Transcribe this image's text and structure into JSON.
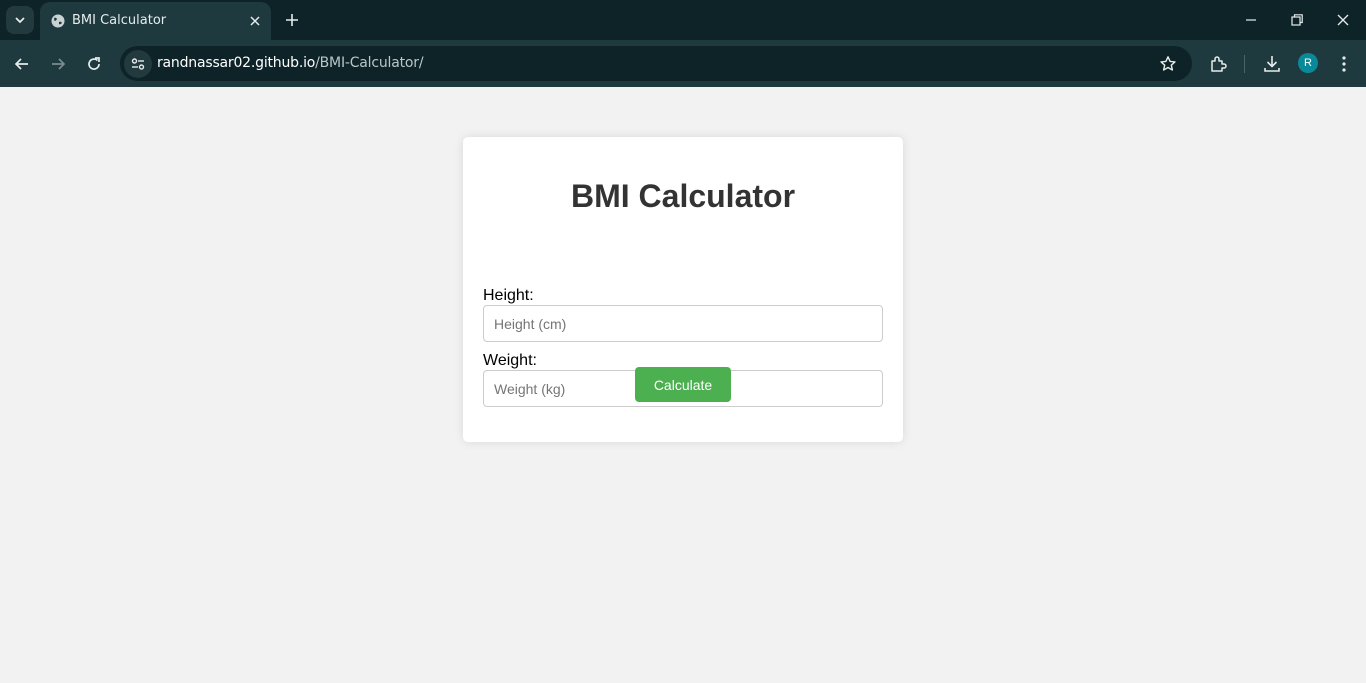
{
  "browser": {
    "tab": {
      "title": "BMI Calculator"
    },
    "address_bar": {
      "host": "randnassar02.github.io",
      "path": "/BMI-Calculator/"
    },
    "profile_initial": "R"
  },
  "app": {
    "title": "BMI Calculator",
    "height": {
      "label": "Height:",
      "placeholder": "Height (cm)",
      "value": ""
    },
    "weight": {
      "label": "Weight:",
      "placeholder": "Weight (kg)",
      "value": ""
    },
    "calculate_label": "Calculate"
  },
  "colors": {
    "chrome_dark": "#0e2327",
    "chrome_toolbar": "#1e3a3f",
    "page_bg": "#f2f2f2",
    "accent_green": "#4caf50",
    "avatar": "#0a8a99"
  },
  "icons": [
    "tab-search-icon",
    "globe-icon",
    "close-icon",
    "plus-icon",
    "minimize-icon",
    "restore-icon",
    "back-icon",
    "forward-icon",
    "reload-icon",
    "site-info-icon",
    "star-icon",
    "extensions-icon",
    "download-icon",
    "more-icon"
  ]
}
